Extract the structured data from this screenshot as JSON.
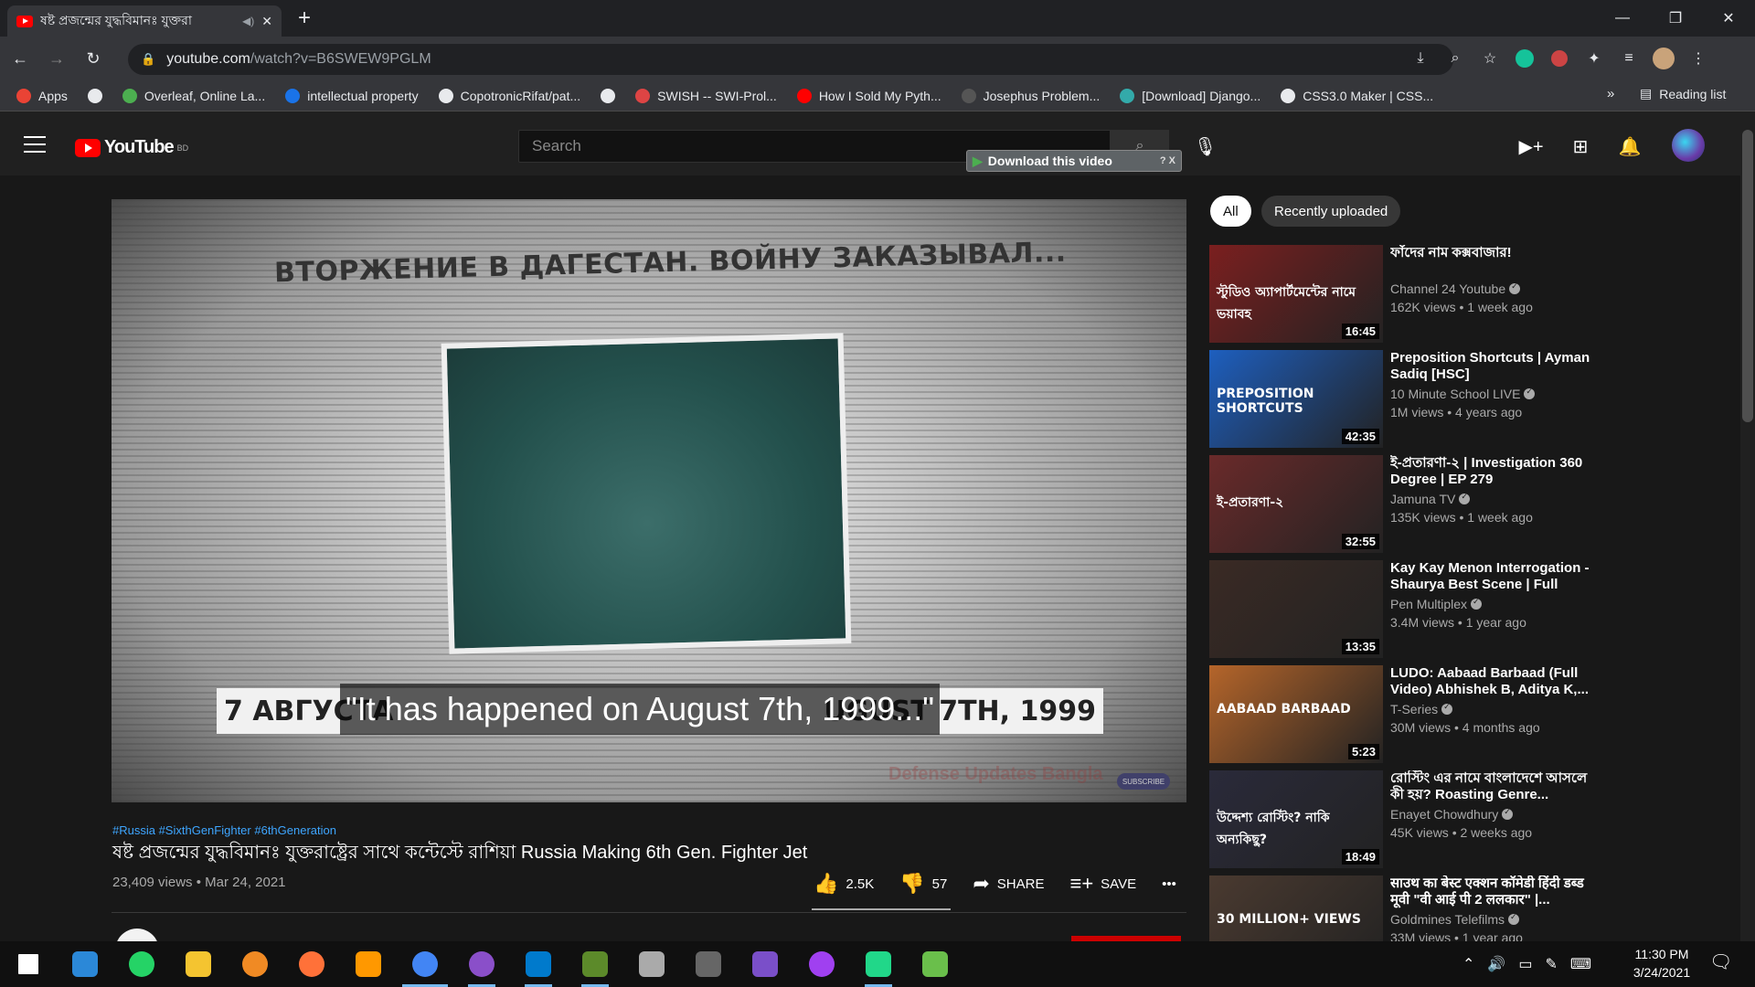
{
  "browser": {
    "tab_title": "ষষ্ট প্রজন্মের যুদ্ধবিমানঃ যুক্তরা",
    "tab_close": "✕",
    "new_tab": "+",
    "url_host": "youtube.com",
    "url_path": "/watch?v=B6SWEW9PGLM",
    "window": {
      "minimize": "—",
      "maximize": "❐",
      "close": "✕"
    },
    "bookmarks": [
      {
        "label": "Apps",
        "color": "#ea4335"
      },
      {
        "label": "",
        "color": "#e8eaed"
      },
      {
        "label": "Overleaf, Online La...",
        "color": "#4caf50"
      },
      {
        "label": "intellectual property",
        "color": "#1a73e8"
      },
      {
        "label": "CopotronicRifat/pat...",
        "color": "#e8eaed"
      },
      {
        "label": "",
        "color": "#e8eaed"
      },
      {
        "label": "SWISH -- SWI-Prol...",
        "color": "#d44"
      },
      {
        "label": "How I Sold My Pyth...",
        "color": "#ff0000"
      },
      {
        "label": "Josephus Problem...",
        "color": "#555"
      },
      {
        "label": "[Download] Django...",
        "color": "#3aa"
      },
      {
        "label": "CSS3.0 Maker | CSS...",
        "color": "#e8eaed"
      }
    ],
    "bookmarks_more": "»",
    "reading_list": "Reading list"
  },
  "youtube": {
    "logo_text": "YouTube",
    "logo_region": "BD",
    "search_placeholder": "Search",
    "download_video_label": "Download this video",
    "download_video_controls": "? X"
  },
  "player": {
    "newspaper_headline": "ВТОРЖЕНИЕ В ДАГЕСТАН. ВОЙНУ ЗАКАЗЫВАЛ...",
    "caption_left": "7 АВГУСТА",
    "caption_right": "UGUST 7TH, 1999",
    "subtitle": "\"It has happened on August 7th, 1999...\"",
    "watermark": "Defense Updates Bangla",
    "subscribe_pill": "SUBSCRIBE"
  },
  "video": {
    "hashtags": "#Russia #SixthGenFighter #6thGeneration",
    "title": "ষষ্ট প্রজন্মের যুদ্ধবিমানঃ যুক্তরাষ্ট্রের সাথে কন্টেস্টে রাশিয়া Russia Making 6th Gen. Fighter Jet",
    "views_date": "23,409 views • Mar 24, 2021",
    "likes": "2.5K",
    "dislikes": "57",
    "share": "SHARE",
    "save": "SAVE",
    "more": "•••"
  },
  "chips": {
    "all": "All",
    "recent": "Recently uploaded"
  },
  "recommendations": [
    {
      "title": "ফাঁদের নাম কক্সবাজার!",
      "channel": "Channel 24 Youtube",
      "views": "162K views • 1 week ago",
      "duration": "16:45",
      "thumb_color": "#7b1f1f",
      "thumb_text": "স্টুডিও অ্যাপার্টমেন্টের নামে ভয়াবহ"
    },
    {
      "title": "Preposition Shortcuts | Ayman Sadiq [HSC]",
      "channel": "10 Minute School LIVE",
      "views": "1M views • 4 years ago",
      "duration": "42:35",
      "thumb_color": "#1e5fbf",
      "thumb_text": "PREPOSITION SHORTCUTS"
    },
    {
      "title": "ই-প্রতারণা-২ | Investigation 360 Degree | EP 279",
      "channel": "Jamuna TV",
      "views": "135K views • 1 week ago",
      "duration": "32:55",
      "thumb_color": "#6a2a2a",
      "thumb_text": "ই-প্রতারণা-২"
    },
    {
      "title": "Kay Kay Menon Interrogation - Shaurya Best Scene | Full Hind...",
      "channel": "Pen Multiplex",
      "views": "3.4M views • 1 year ago",
      "duration": "13:35",
      "thumb_color": "#3a2a24",
      "thumb_text": ""
    },
    {
      "title": "LUDO: Aabaad Barbaad (Full Video) Abhishek B, Aditya K,...",
      "channel": "T-Series",
      "views": "30M views • 4 months ago",
      "duration": "5:23",
      "thumb_color": "#b5652a",
      "thumb_text": "AABAAD BARBAAD"
    },
    {
      "title": "রোস্টিং এর নামে বাংলাদেশে আসলে কী হয়? Roasting Genre...",
      "channel": "Enayet Chowdhury",
      "views": "45K views • 2 weeks ago",
      "duration": "18:49",
      "thumb_color": "#2a2a3a",
      "thumb_text": "উদ্দেশ্য রোস্টিং? নাকি অন্যকিছু?"
    },
    {
      "title": "साउथ का बेस्ट एक्शन कॉमेडी हिंदी डब्ड मूवी \"वी आई पी 2 ललकार\" |...",
      "channel": "Goldmines Telefilms",
      "views": "33M views • 1 year ago",
      "duration": "",
      "thumb_color": "#4a3a30",
      "thumb_text": "30 MILLION+ VIEWS"
    }
  ],
  "taskbar": {
    "apps": [
      {
        "name": "windows",
        "color": "#ffffff"
      },
      {
        "name": "search",
        "color": "#2b88d8"
      },
      {
        "name": "whatsapp",
        "color": "#25d366"
      },
      {
        "name": "file-explorer",
        "color": "#f4c430"
      },
      {
        "name": "brave",
        "color": "#f08a24"
      },
      {
        "name": "firefox",
        "color": "#ff7139"
      },
      {
        "name": "sublime",
        "color": "#ff9800"
      },
      {
        "name": "chrome",
        "color": "#4285f4"
      },
      {
        "name": "github",
        "color": "#8a4fc9"
      },
      {
        "name": "vscode",
        "color": "#007acc"
      },
      {
        "name": "gimp",
        "color": "#5c8a2a"
      },
      {
        "name": "inkscape",
        "color": "#aaaaaa"
      },
      {
        "name": "anaconda",
        "color": "#666666"
      },
      {
        "name": "visual-studio",
        "color": "#7a4fc9"
      },
      {
        "name": "messenger",
        "color": "#a040f0"
      },
      {
        "name": "pycharm",
        "color": "#21d789"
      },
      {
        "name": "notepad",
        "color": "#6abf4b"
      }
    ],
    "time": "11:30 PM",
    "date": "3/24/2021"
  }
}
